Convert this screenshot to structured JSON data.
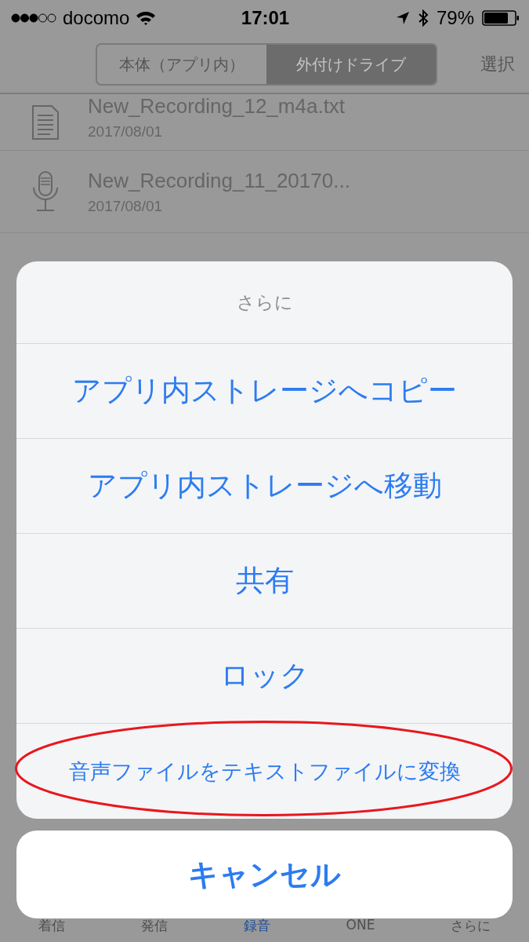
{
  "status_bar": {
    "carrier": "docomo",
    "time": "17:01",
    "battery": "79%"
  },
  "segments": [
    {
      "label": "本体（アプリ内）",
      "selected": false
    },
    {
      "label": "外付けドライブ",
      "selected": true
    }
  ],
  "select_button": "選択",
  "files": [
    {
      "kind": "text",
      "name": "New_Recording_12_m4a.txt",
      "date": "2017/08/01"
    },
    {
      "kind": "audio",
      "name": "New_Recording_11_20170...",
      "date": "2017/08/01"
    }
  ],
  "action_sheet": {
    "title": "さらに",
    "actions": [
      {
        "label": "アプリ内ストレージへコピー",
        "highlighted": false
      },
      {
        "label": "アプリ内ストレージへ移動",
        "highlighted": false
      },
      {
        "label": "共有",
        "highlighted": false
      },
      {
        "label": "ロック",
        "highlighted": false
      },
      {
        "label": "音声ファイルをテキストファイルに変換",
        "highlighted": true
      }
    ],
    "cancel": "キャンセル"
  },
  "tabs": [
    {
      "label": "着信",
      "selected": false
    },
    {
      "label": "発信",
      "selected": false
    },
    {
      "label": "録音",
      "selected": true
    },
    {
      "label": "ONE",
      "selected": false
    },
    {
      "label": "さらに",
      "selected": false
    }
  ]
}
